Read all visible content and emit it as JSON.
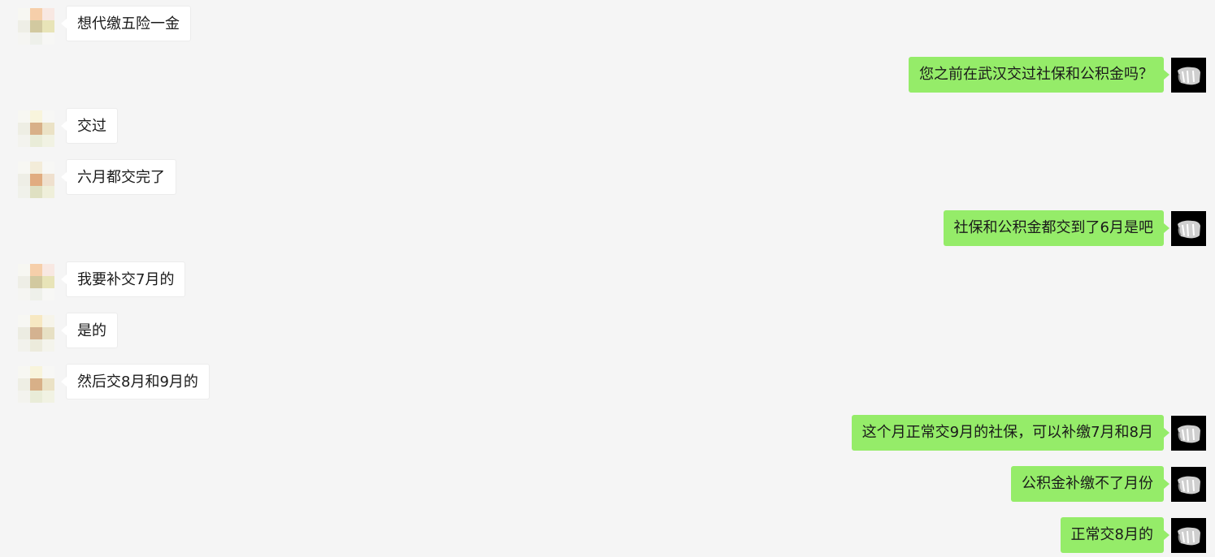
{
  "colors": {
    "background": "#f5f5f5",
    "incoming_bubble": "#ffffff",
    "outgoing_bubble": "#95ec69",
    "text": "#1a1a1a"
  },
  "messages": [
    {
      "direction": "incoming",
      "text": "想代缴五险一金",
      "avatar": "avatar-a"
    },
    {
      "direction": "outgoing",
      "text": "您之前在武汉交过社保和公积金吗？"
    },
    {
      "direction": "incoming",
      "text": "交过",
      "avatar": "avatar-b"
    },
    {
      "direction": "incoming",
      "text": "六月都交完了",
      "avatar": "avatar-c"
    },
    {
      "direction": "outgoing",
      "text": "社保和公积金都交到了6月是吧"
    },
    {
      "direction": "incoming",
      "text": "我要补交7月的",
      "avatar": "avatar-a"
    },
    {
      "direction": "incoming",
      "text": "是的",
      "avatar": "avatar-d"
    },
    {
      "direction": "incoming",
      "text": "然后交8月和9月的",
      "avatar": "avatar-b"
    },
    {
      "direction": "outgoing",
      "text": "这个月正常交9月的社保，可以补缴7月和8月"
    },
    {
      "direction": "outgoing",
      "text": "公积金补缴不了月份"
    },
    {
      "direction": "outgoing",
      "text": "正常交8月的"
    }
  ]
}
